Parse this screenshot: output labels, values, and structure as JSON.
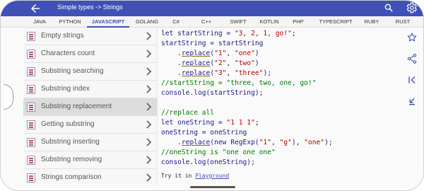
{
  "app": {
    "title": "Simple types -> Strings"
  },
  "colors": {
    "appbar": "#3f51b5",
    "keyword": "#1a1a8c",
    "string": "#b40000",
    "comment": "#007a00"
  },
  "tabs": [
    {
      "label": "JAVA"
    },
    {
      "label": "PYTHON"
    },
    {
      "label": "JAVASCRIPT",
      "active": true
    },
    {
      "label": "GOLANG"
    },
    {
      "label": "C#"
    },
    {
      "label": "C++"
    },
    {
      "label": "SWIFT"
    },
    {
      "label": "KOTLIN"
    },
    {
      "label": "PHP"
    },
    {
      "label": "TYPESCRIPT"
    },
    {
      "label": "RUBY"
    },
    {
      "label": "RUST"
    }
  ],
  "sidebar": {
    "items": [
      {
        "label": "Empty strings"
      },
      {
        "label": "Characters count"
      },
      {
        "label": "Substring searching"
      },
      {
        "label": "Substring index"
      },
      {
        "label": "Substring replacement",
        "selected": true
      },
      {
        "label": "Getting substring"
      },
      {
        "label": "Substring inserting"
      },
      {
        "label": "Substring removing"
      },
      {
        "label": "Strings comparison"
      }
    ]
  },
  "code": {
    "l1_kw": "let ",
    "l1_var": "startString = ",
    "l1_str": "\"3, 2, 1, go!\"",
    "l1_end": ";",
    "l2": "startString = startString",
    "l3_pre": "    .",
    "l3_fn": "replace",
    "l3_a": "(",
    "l3_s1": "\"1\"",
    "l3_b": ", ",
    "l3_s2": "\"one\"",
    "l3_c": ")",
    "l4_pre": "    .",
    "l4_fn": "replace",
    "l4_a": "(",
    "l4_s1": "\"2\"",
    "l4_b": ", ",
    "l4_s2": "\"two\"",
    "l4_c": ")",
    "l5_pre": "    .",
    "l5_fn": "replace",
    "l5_a": "(",
    "l5_s1": "\"3\"",
    "l5_b": ", ",
    "l5_s2": "\"three\"",
    "l5_c": ");",
    "l6": "//startString = \"three, two, one, go!\"",
    "l7": "console.log(startString);",
    "l9": "//replace all",
    "l10_kw": "let ",
    "l10_var": "oneString = ",
    "l10_str": "\"1 1 1\"",
    "l10_end": ";",
    "l11": "oneString = oneString",
    "l12_pre": "    .",
    "l12_fn": "replace",
    "l12_a": "(new RegExp(",
    "l12_s1": "\"1\"",
    "l12_b": ", ",
    "l12_s2": "\"g\"",
    "l12_c": "), ",
    "l12_s3": "\"one\"",
    "l12_d": ");",
    "l13": "//oneString is \"one one one\"",
    "l14": "console.log(oneString);",
    "try_label": "Try it in ",
    "try_link": "Playground"
  },
  "icons": {
    "back": "arrow-back-icon",
    "search": "search-icon",
    "settings": "gear-icon",
    "rail": [
      "star-outline-icon",
      "share-icon",
      "first-page-icon",
      "collapse-icon"
    ],
    "list_item": "string-doc-icon",
    "chevron": "chevron-right-icon"
  }
}
